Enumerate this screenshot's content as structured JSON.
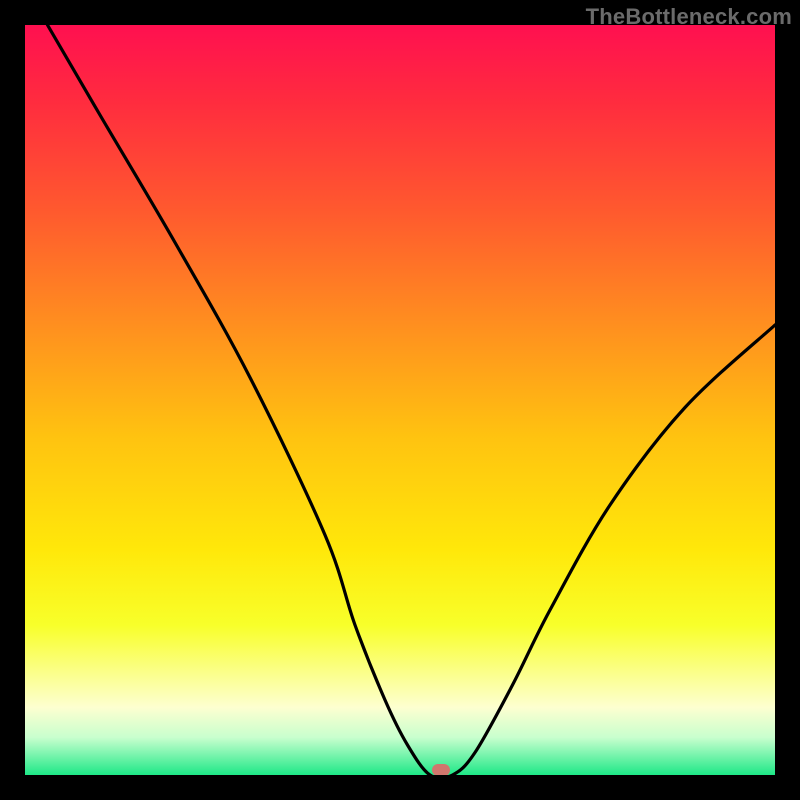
{
  "watermark": "TheBottleneck.com",
  "chart_data": {
    "type": "line",
    "title": "",
    "xlabel": "",
    "ylabel": "",
    "xlim": [
      0,
      100
    ],
    "ylim": [
      0,
      100
    ],
    "grid": false,
    "legend": false,
    "series": [
      {
        "name": "curve",
        "color": "#000000",
        "x": [
          3,
          10,
          20,
          30,
          40,
          44,
          48,
          51,
          54,
          57,
          60,
          65,
          70,
          78,
          88,
          100
        ],
        "y": [
          100,
          88,
          71,
          53,
          32,
          20,
          10,
          4,
          0,
          0,
          3,
          12,
          22,
          36,
          49,
          60
        ]
      }
    ],
    "marker": {
      "x": 55.5,
      "y": 0,
      "color": "#d1766d"
    },
    "background": "vertical-gradient red→orange→yellow→green"
  }
}
